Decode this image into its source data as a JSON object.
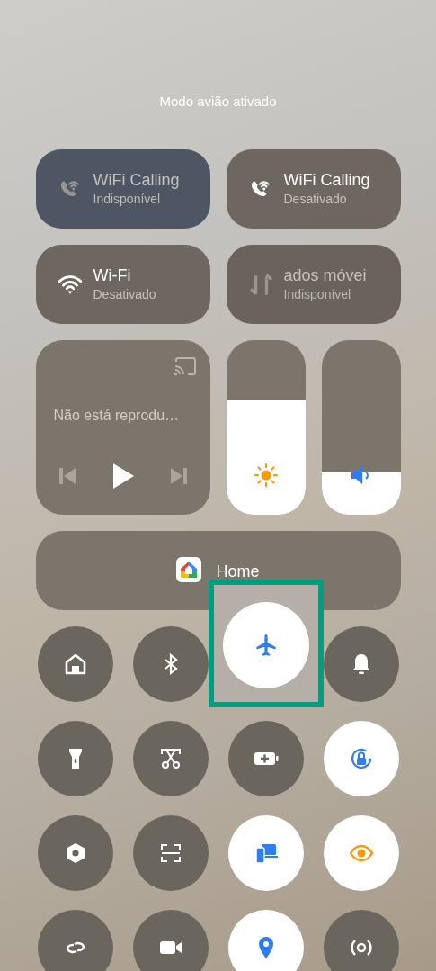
{
  "status_message": "Modo avião ativado",
  "tiles": [
    {
      "title": "WiFi Calling",
      "subtitle": "Indisponível",
      "disabled": true
    },
    {
      "title": "WiFi Calling",
      "subtitle": "Desativado",
      "disabled": false
    },
    {
      "title": "Wi-Fi",
      "subtitle": "Desativado",
      "disabled": false
    },
    {
      "title": "ados móvei",
      "subtitle": "Indisponível",
      "disabled": true
    }
  ],
  "media": {
    "status": "Não está reprodu…"
  },
  "sliders": [
    {
      "kind": "brightness",
      "level": 0.66
    },
    {
      "kind": "volume",
      "level": 0.24
    }
  ],
  "shortcut": {
    "label": "Home"
  },
  "toggles": [
    {
      "on": false,
      "highlighted": false
    },
    {
      "on": false,
      "highlighted": false
    },
    {
      "on": true,
      "highlighted": true
    },
    {
      "on": false,
      "highlighted": false
    },
    {
      "on": false,
      "highlighted": false
    },
    {
      "on": false,
      "highlighted": false
    },
    {
      "on": false,
      "highlighted": false
    },
    {
      "on": true,
      "highlighted": false
    },
    {
      "on": false,
      "highlighted": false
    },
    {
      "on": false,
      "highlighted": false
    },
    {
      "on": true,
      "highlighted": false
    },
    {
      "on": true,
      "highlighted": false
    },
    {
      "on": false,
      "highlighted": false
    },
    {
      "on": false,
      "highlighted": false
    },
    {
      "on": true,
      "highlighted": false
    },
    {
      "on": false,
      "highlighted": false
    }
  ]
}
